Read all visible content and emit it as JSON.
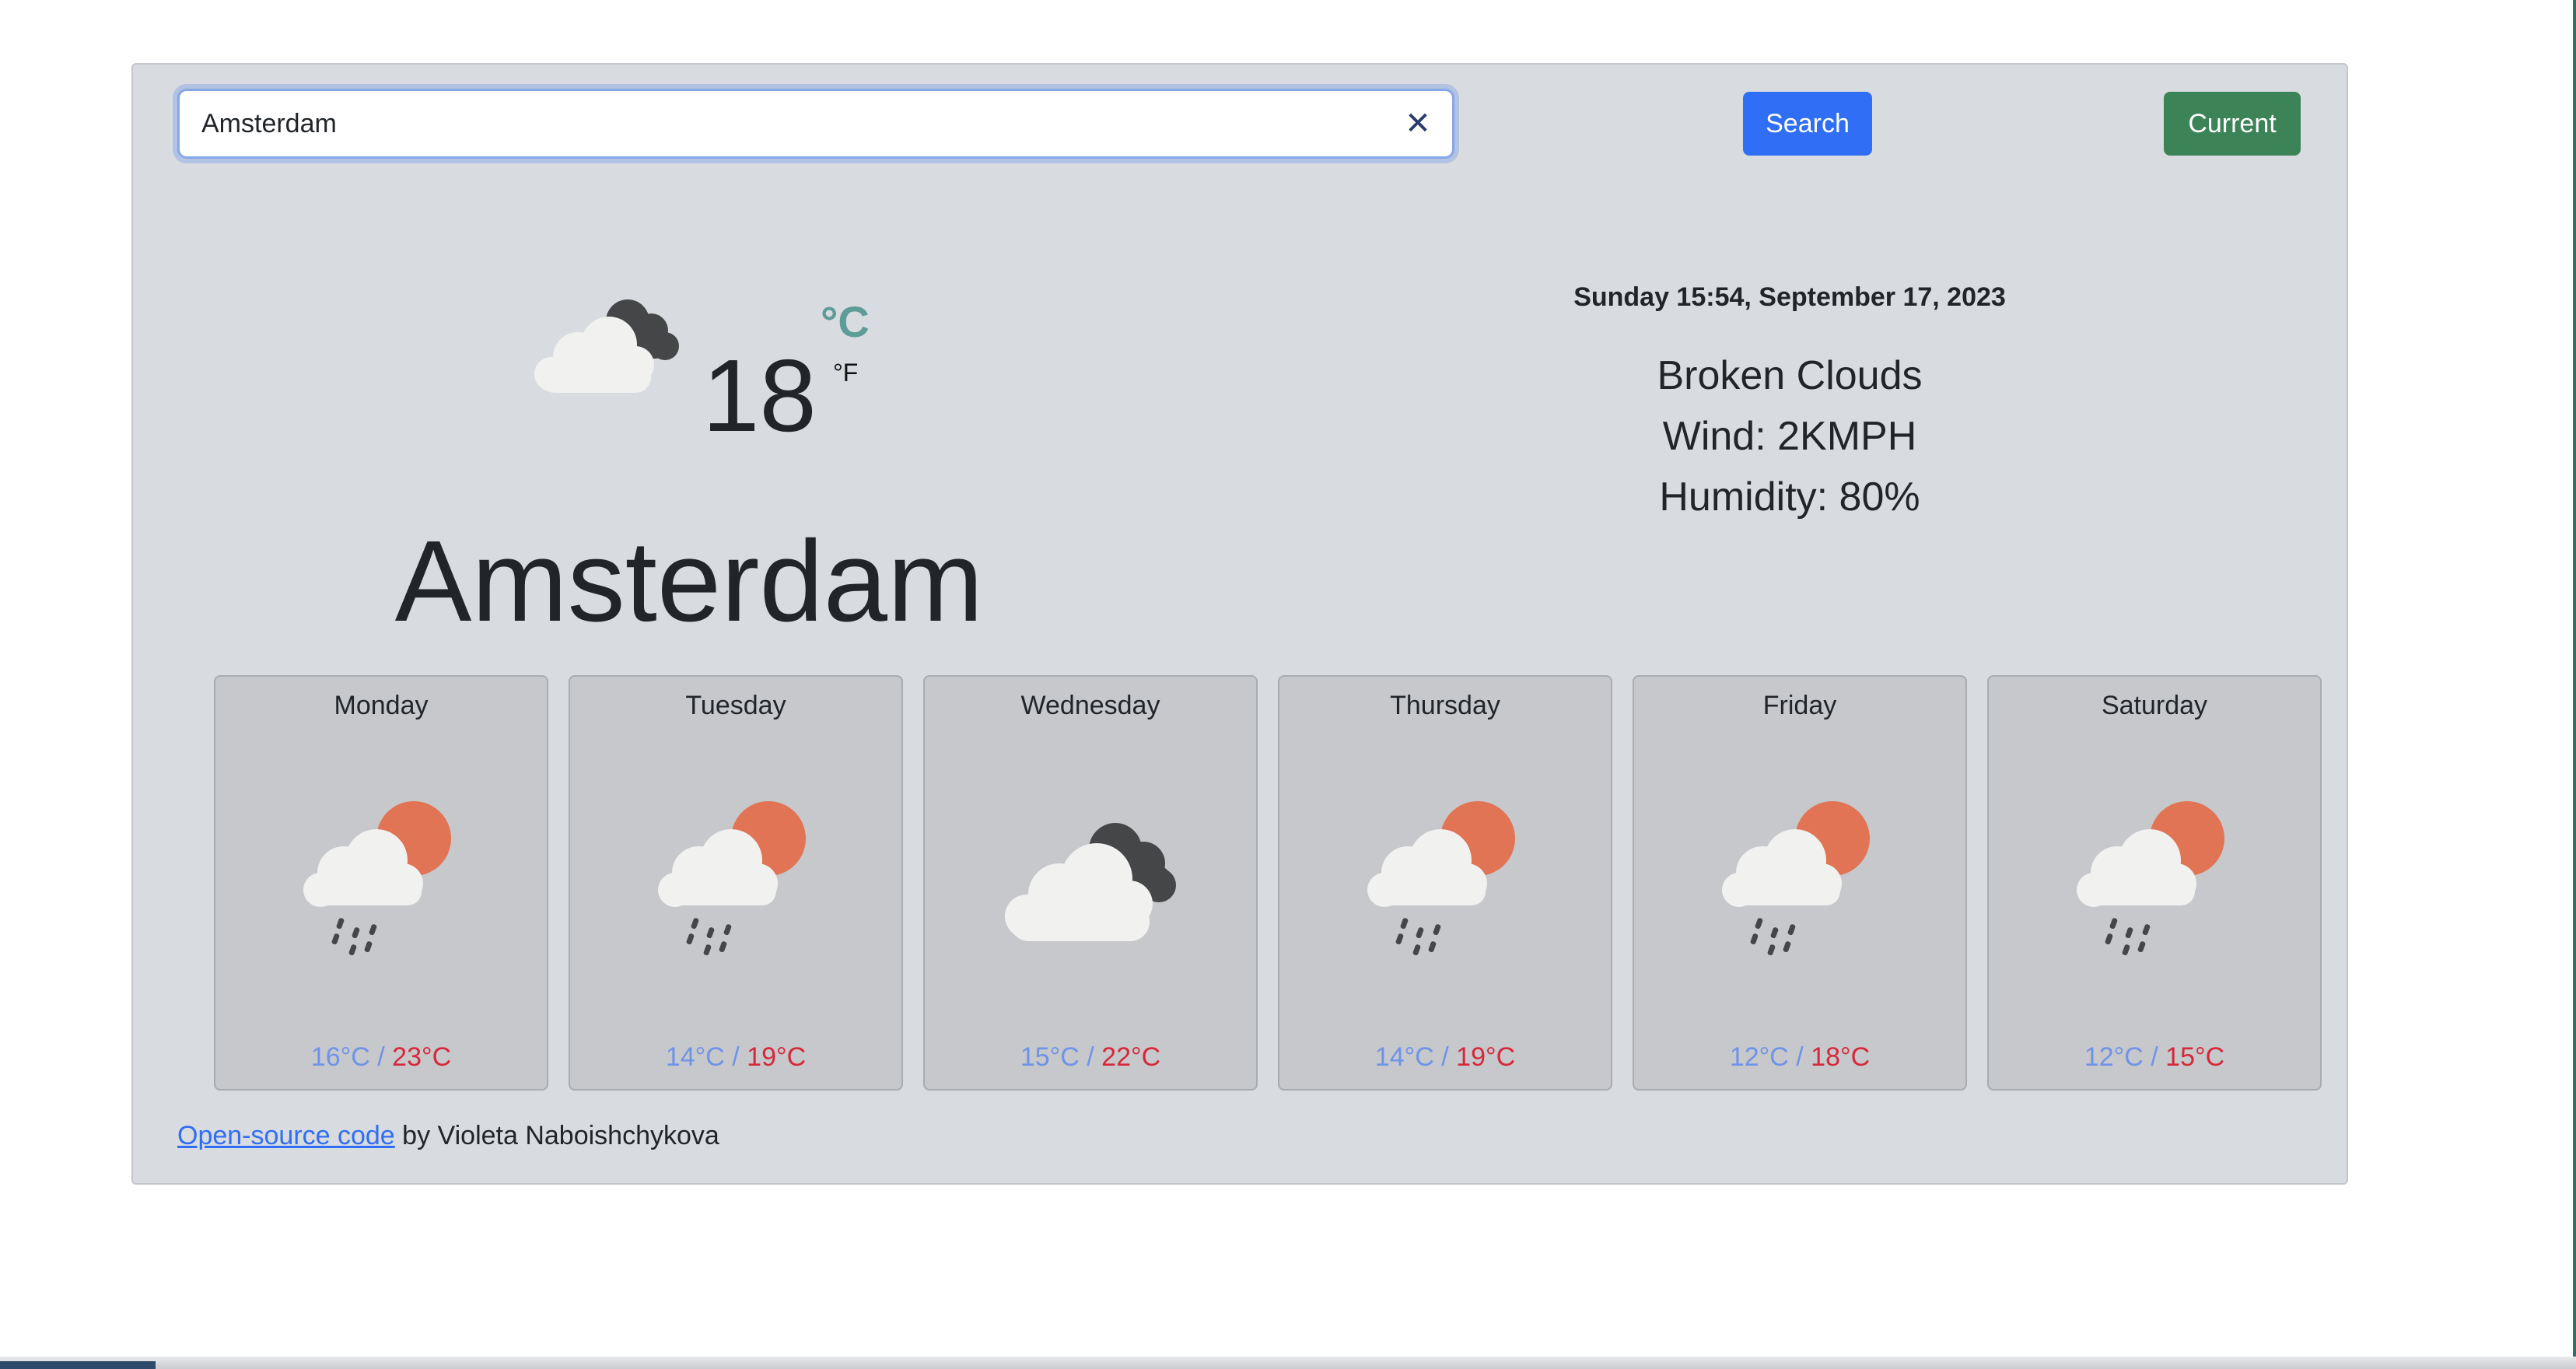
{
  "search": {
    "value": "Amsterdam",
    "clear_icon": "close-icon",
    "search_label": "Search",
    "current_label": "Current"
  },
  "current": {
    "icon": "broken-clouds-icon",
    "temperature": "18",
    "unit_celsius": "°C",
    "unit_fahrenheit": "°F",
    "city": "Amsterdam",
    "datetime": "Sunday 15:54, September 17, 2023",
    "condition": "Broken Clouds",
    "wind": "Wind: 2KMPH",
    "humidity": "Humidity: 80%"
  },
  "forecast": [
    {
      "day": "Monday",
      "icon": "rain-sun-icon",
      "min": "16°C",
      "max": "23°C"
    },
    {
      "day": "Tuesday",
      "icon": "rain-sun-icon",
      "min": "14°C",
      "max": "19°C"
    },
    {
      "day": "Wednesday",
      "icon": "broken-clouds-icon",
      "min": "15°C",
      "max": "22°C"
    },
    {
      "day": "Thursday",
      "icon": "rain-sun-icon",
      "min": "14°C",
      "max": "19°C"
    },
    {
      "day": "Friday",
      "icon": "rain-sun-icon",
      "min": "12°C",
      "max": "18°C"
    },
    {
      "day": "Saturday",
      "icon": "rain-sun-icon",
      "min": "12°C",
      "max": "15°C"
    }
  ],
  "forecast_separator": "/",
  "footer": {
    "link_text": "Open-source code",
    "suffix": " by Violeta Naboishchykova"
  },
  "colors": {
    "search_button": "#2f6ef5",
    "current_button": "#3c8357",
    "min_temp": "#6f93e8",
    "max_temp": "#d6283a",
    "celsius_accent": "#5e9c98"
  }
}
